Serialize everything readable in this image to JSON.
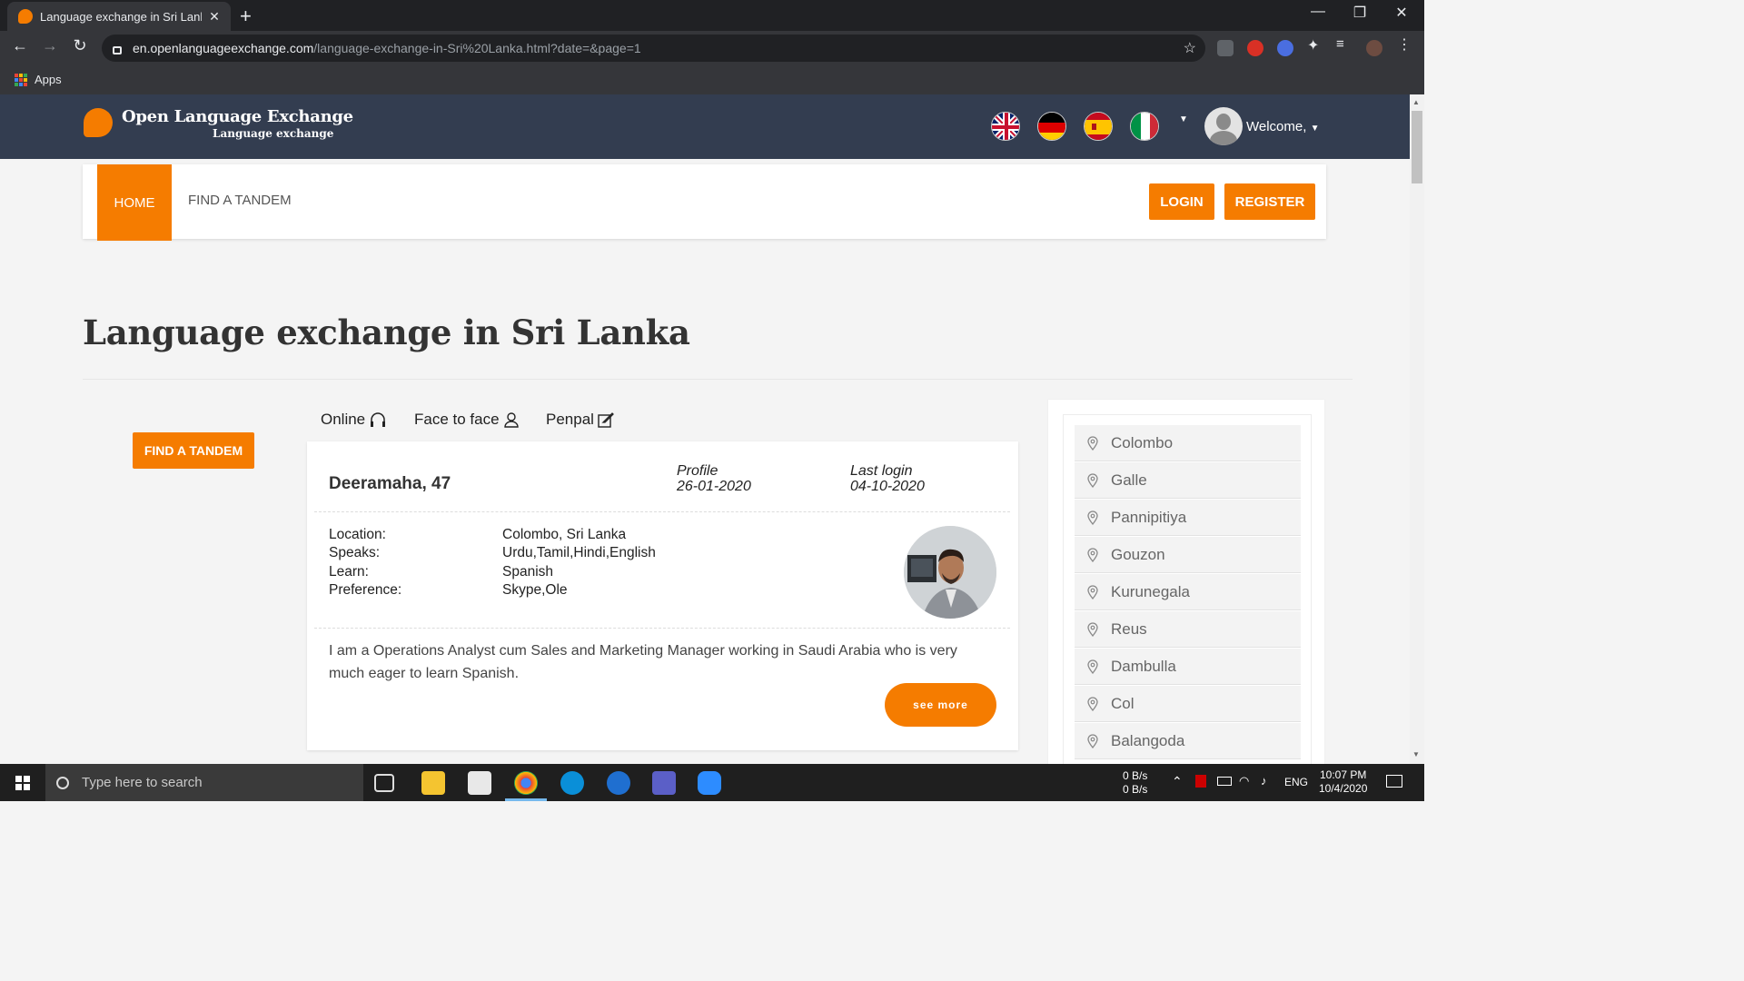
{
  "browser": {
    "tab_title": "Language exchange in Sri Lanka",
    "url_host": "en.openlanguageexchange.com",
    "url_path": "/language-exchange-in-Sri%20Lanka.html?date=&page=1",
    "bookmarks_apps": "Apps"
  },
  "site": {
    "logo_title": "Open Language Exchange",
    "logo_subtitle": "Language exchange",
    "flags": [
      "uk-flag",
      "germany-flag",
      "spain-flag",
      "italy-flag"
    ],
    "welcome": "Welcome,"
  },
  "nav": {
    "home": "HOME",
    "find_tandem": "FIND A TANDEM",
    "login": "LOGIN",
    "register": "REGISTER"
  },
  "page": {
    "title": "Language exchange in Sri Lanka",
    "find_tandem_button": "FIND A TANDEM",
    "filters": [
      "Online",
      "Face to face",
      "Penpal"
    ]
  },
  "profile": {
    "name": "Deeramaha, 47",
    "profile_label": "Profile",
    "profile_date": "26-01-2020",
    "last_login_label": "Last login",
    "last_login_date": "04-10-2020",
    "rows": [
      {
        "label": "Location:",
        "value": "Colombo, Sri Lanka"
      },
      {
        "label": "Speaks:",
        "value": "Urdu,Tamil,Hindi,English"
      },
      {
        "label": "Learn:",
        "value": "Spanish"
      },
      {
        "label": "Preference:",
        "value": "Skype,Ole"
      }
    ],
    "description": "I am a Operations Analyst cum Sales and Marketing Manager working in Saudi Arabia who is very much eager to learn Spanish.",
    "see_more": "see more"
  },
  "cities": [
    "Colombo",
    "Galle",
    "Pannipitiya",
    "Gouzon",
    "Kurunegala",
    "Reus",
    "Dambulla",
    "Col",
    "Balangoda"
  ],
  "taskbar": {
    "search_placeholder": "Type here to search",
    "net_up": "0 B/s",
    "net_down": "0 B/s",
    "lang": "ENG",
    "time": "10:07 PM",
    "date": "10/4/2020"
  },
  "colors": {
    "accent": "#f57c00",
    "header_bg": "#333d50"
  }
}
